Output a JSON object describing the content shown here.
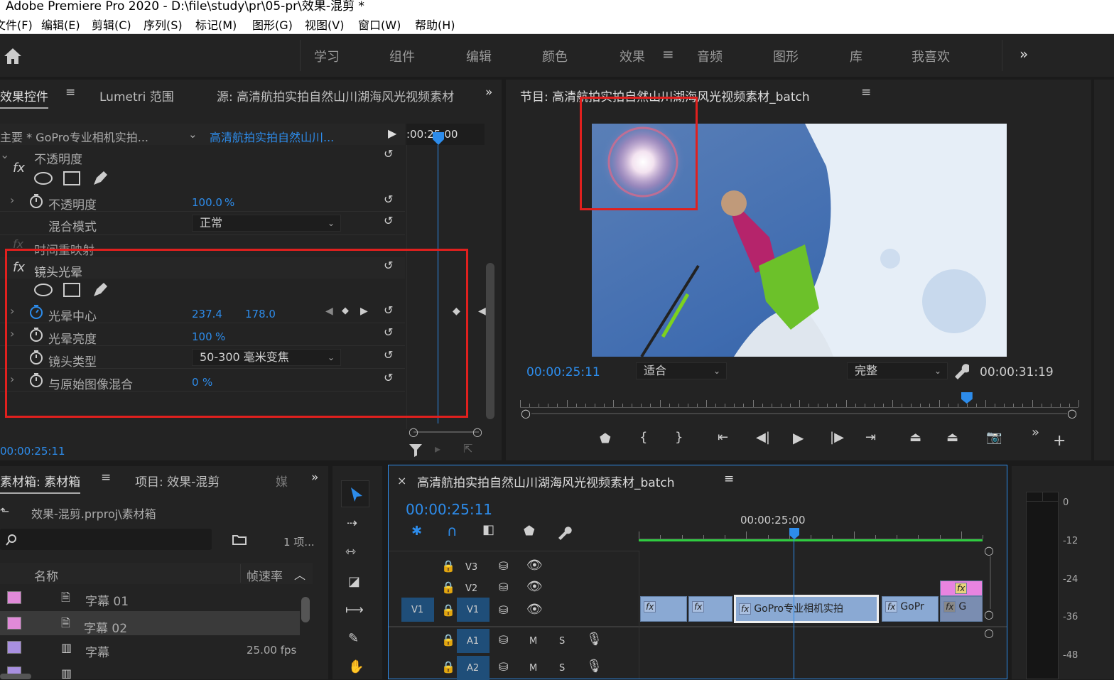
{
  "window": {
    "title": "Adobe Premiere Pro 2020 - D:\\file\\study\\pr\\05-pr\\效果-混剪 *"
  },
  "menu": [
    "文件(F)",
    "编辑(E)",
    "剪辑(C)",
    "序列(S)",
    "标记(M)",
    "图形(G)",
    "视图(V)",
    "窗口(W)",
    "帮助(H)"
  ],
  "workspaces": {
    "items": [
      "学习",
      "组件",
      "编辑",
      "颜色",
      "效果",
      "音频",
      "图形",
      "库",
      "我喜欢"
    ],
    "active": "效果",
    "more": "»"
  },
  "effect_controls": {
    "tab_active": "效果控件",
    "tab_lumetri": "Lumetri 范围",
    "tab_source": "源: 高清航拍实拍自然山川湖海风光视频素材_batch",
    "master": "主要 * GoPro专业相机实拍...",
    "clip": "高清航拍实拍自然山川...",
    "ruler_time": ":00:25:00",
    "opacity": {
      "name": "不透明度",
      "prop": "不透明度",
      "value": "100.0",
      "unit": "%",
      "blend_label": "混合模式",
      "blend_value": "正常"
    },
    "time_remap": "时间重映射",
    "lens_flare": {
      "name": "镜头光晕",
      "center_label": "光晕中心",
      "center_x": "237.4",
      "center_y": "178.0",
      "brightness_label": "光晕亮度",
      "brightness_value": "100",
      "brightness_unit": "%",
      "type_label": "镜头类型",
      "type_value": "50-300 毫米变焦",
      "blend_label": "与原始图像混合",
      "blend_value": "0",
      "blend_unit": "%"
    },
    "timecode": "00:00:25:11",
    "fx_symbol": "fx"
  },
  "program": {
    "title": "节目: 高清航拍实拍自然山川湖海风光视频素材_batch",
    "timecode": "00:00:25:11",
    "fit": "适合",
    "quality": "完整",
    "duration": "00:00:31:19",
    "playhead_fraction": 0.8
  },
  "bin": {
    "tab_active": "素材箱: 素材箱",
    "tab_project": "项目: 效果-混剪",
    "tab_more": "媒",
    "path": "效果-混剪.prproj\\素材箱",
    "count": "1 项...",
    "col_name": "名称",
    "col_fps": "帧速率",
    "rows": [
      {
        "name": "字幕 01",
        "fps": "",
        "color": "#e08ad8"
      },
      {
        "name": "字幕 02",
        "fps": "",
        "color": "#e08ad8"
      },
      {
        "name": "字幕",
        "fps": "25.00 fps",
        "color": "#a88fe0"
      },
      {
        "name": "",
        "fps": "",
        "color": "#a88fe0"
      }
    ]
  },
  "timeline": {
    "title": "高清航拍实拍自然山川湖海风光视频素材_batch",
    "timecode": "00:00:25:11",
    "ruler_label": "00:00:25:00",
    "tracks": {
      "v3": "V3",
      "v2": "V2",
      "v1": "V1",
      "v1_src": "V1",
      "a1": "A1",
      "a2": "A2",
      "mute": "M",
      "solo": "S"
    },
    "clips": [
      {
        "label": ""
      },
      {
        "label": ""
      },
      {
        "label": "GoPro专业相机实拍"
      },
      {
        "label": "GoPr"
      },
      {
        "label": "G"
      }
    ]
  },
  "meter": {
    "ticks": [
      "0",
      "-12",
      "-24",
      "-36",
      "-48"
    ]
  },
  "colors": {
    "accent": "#2d8ceb",
    "highlight": "#e0201e",
    "clip": "#8aa9d3"
  }
}
